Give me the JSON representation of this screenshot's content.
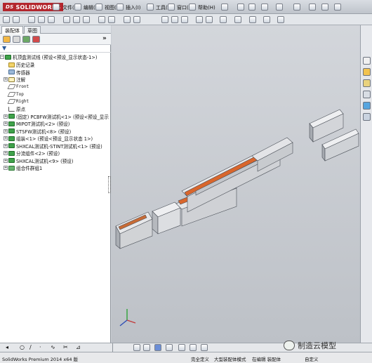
{
  "app": {
    "brand": "SOLIDWORKS",
    "brand_prefix": "DS"
  },
  "menu": [
    "文件(F)",
    "编辑(E)",
    "视图(V)",
    "插入(I)",
    "工具(T)",
    "窗口(W)",
    "帮助(H)"
  ],
  "panel_tabs": [
    "装配体",
    "草图"
  ],
  "tree": {
    "root": "机顶盒测试线 (预设<预设_显示状态-1>)",
    "items": [
      "历史记录",
      "传感器",
      "注解",
      "Front",
      "Top",
      "Right",
      "原点",
      "(固定) PCBFW测试机<1> (预设<预设_显示",
      "MIPOT测试机<2> (预设)",
      "STSFW测试机<8> (预设)",
      "组装<1> (预设<预设_显示状态 1>)",
      "SHXCAL测试机-STINT测试机<1> (预设)",
      "分流组件<2> (预设)",
      "SHXCAL测试机<9> (预设)",
      "组合件群组1"
    ]
  },
  "status": {
    "product": "SolidWorks Premium 2014 x64 版",
    "state1": "完全定义",
    "state2": "大型装配体模式",
    "state3": "在编辑 装配体",
    "state4": "自定义"
  },
  "watermark": "制造云模型",
  "colors": {
    "brand": "#b3262d",
    "viewport_top": "#d3d6db",
    "accent": "#d9662c"
  }
}
